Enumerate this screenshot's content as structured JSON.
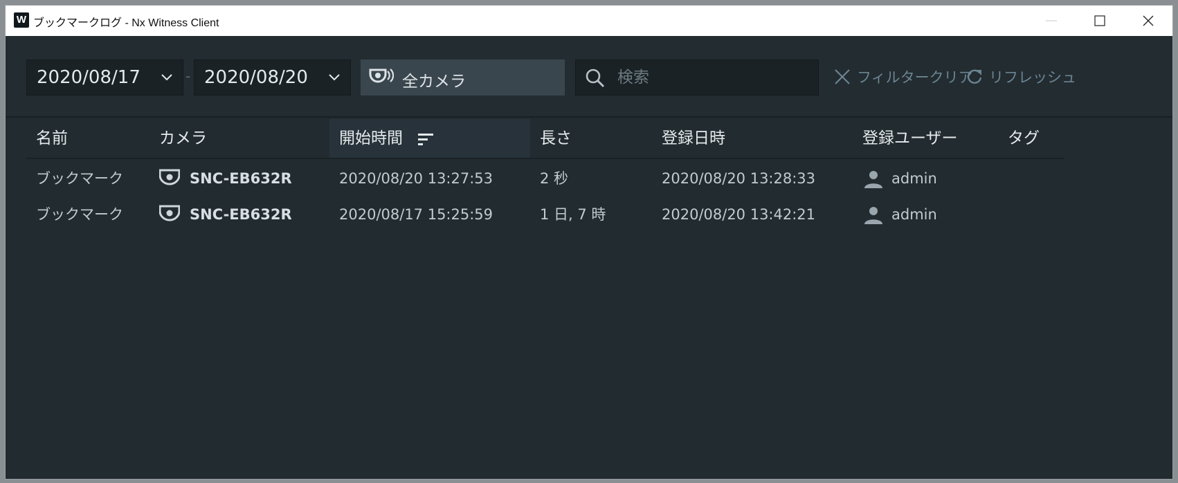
{
  "window": {
    "title": "ブックマークログ - Nx Witness Client",
    "logo_letter": "W"
  },
  "toolbar": {
    "date_from": "2020/08/17",
    "date_separator": "-",
    "date_to": "2020/08/20",
    "camera_filter": "全カメラ",
    "search_placeholder": "検索",
    "clear_filter": "フィルタークリア",
    "refresh": "リフレッシュ"
  },
  "table": {
    "columns": [
      "名前",
      "カメラ",
      "開始時間",
      "長さ",
      "登録日時",
      "登録ユーザー",
      "タグ"
    ],
    "sorted_column": "開始時間",
    "rows": [
      {
        "name": "ブックマーク",
        "camera": "SNC-EB632R",
        "start": "2020/08/20 13:27:53",
        "length": "2 秒",
        "created": "2020/08/20 13:28:33",
        "user": "admin",
        "tags": ""
      },
      {
        "name": "ブックマーク",
        "camera": "SNC-EB632R",
        "start": "2020/08/17 15:25:59",
        "length": "1 日, 7 時",
        "created": "2020/08/20 13:42:21",
        "user": "admin",
        "tags": ""
      }
    ]
  },
  "colors": {
    "background": "#222b30",
    "toolbar": "#232c31",
    "selector": "#3a464e",
    "link": "#6b8592"
  },
  "icons": {
    "camera": "dome-camera-icon",
    "user": "user-icon",
    "search": "search-icon",
    "clear": "close-icon",
    "refresh": "refresh-icon",
    "sort": "sort-descending-icon"
  }
}
